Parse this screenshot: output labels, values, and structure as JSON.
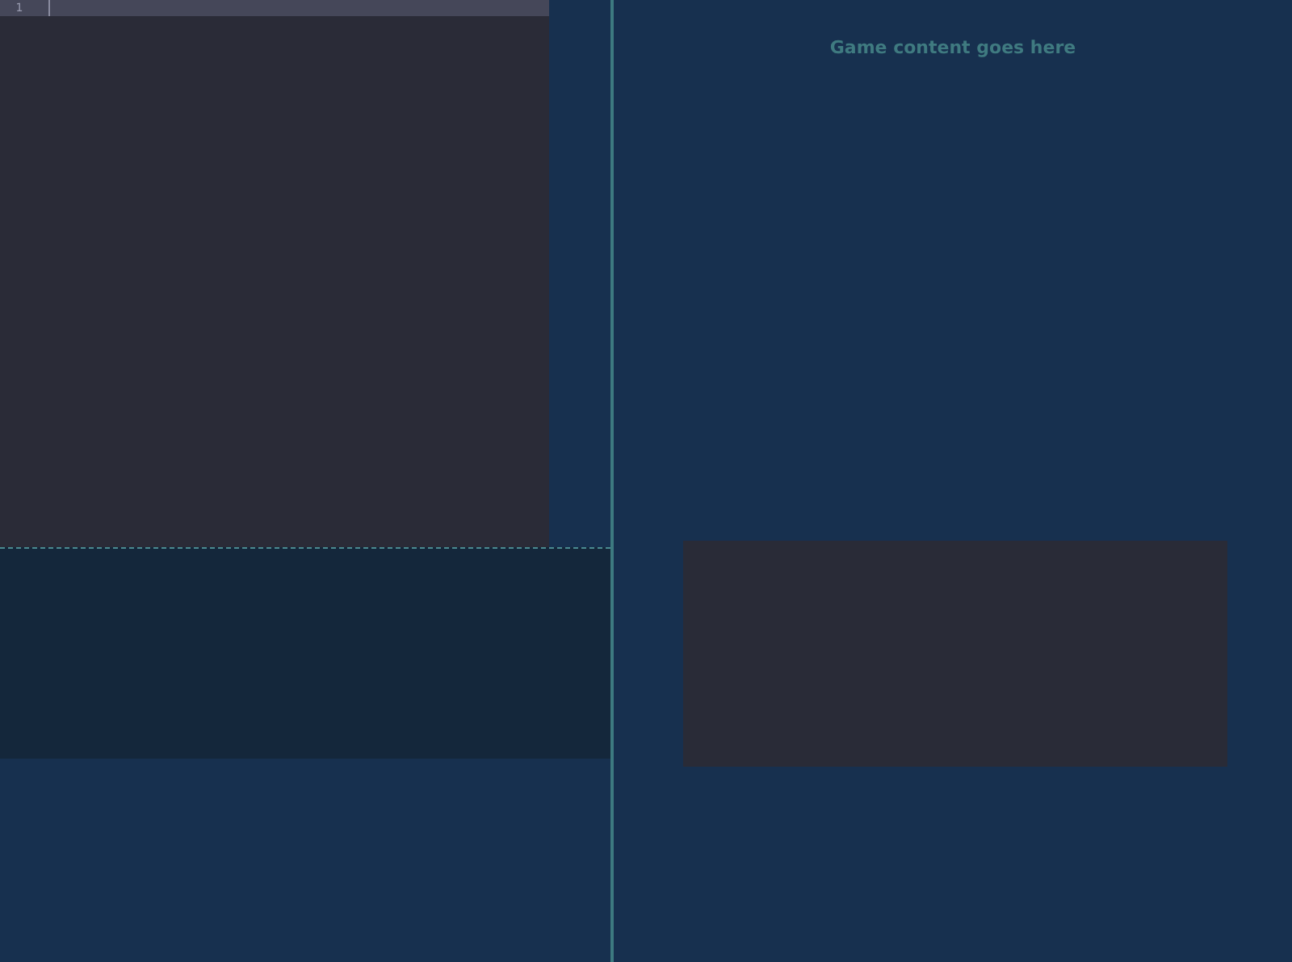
{
  "editor": {
    "line_numbers": [
      "1"
    ]
  },
  "game": {
    "message": "Game content goes here"
  }
}
